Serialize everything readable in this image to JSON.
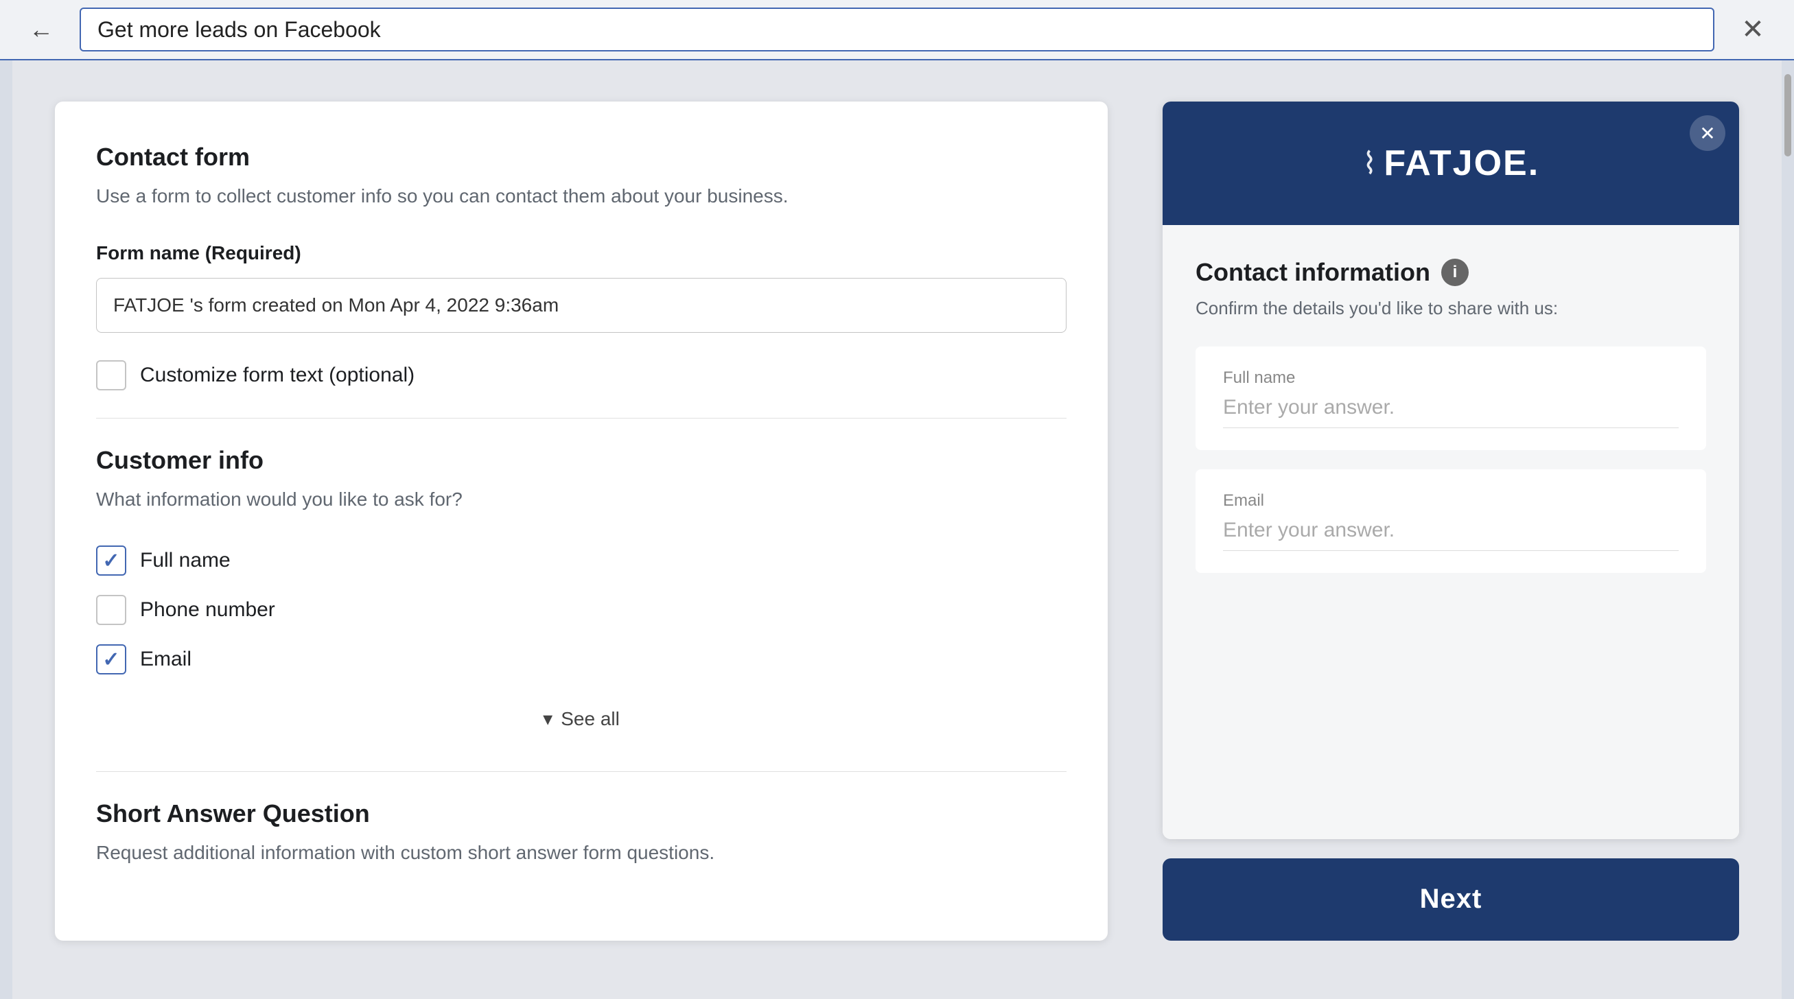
{
  "topBar": {
    "backLabel": "←",
    "addressText": "Get more leads on Facebook",
    "closeLabel": "✕"
  },
  "leftPanel": {
    "contactForm": {
      "title": "Contact form",
      "description": "Use a form to collect customer info so you can contact them about your business.",
      "formNameLabel": "Form name (Required)",
      "formNameValue": "FATJOE 's form created on Mon Apr 4, 2022 9:36am",
      "customizeLabel": "Customize form text (optional)"
    },
    "customerInfo": {
      "title": "Customer info",
      "description": "What information would you like to ask for?",
      "fields": [
        {
          "label": "Full name",
          "checked": true
        },
        {
          "label": "Phone number",
          "checked": false
        },
        {
          "label": "Email",
          "checked": true
        }
      ],
      "seeAllLabel": "See all"
    },
    "shortAnswer": {
      "title": "Short Answer Question",
      "description": "Request additional information with custom short answer form questions."
    }
  },
  "rightPanel": {
    "logo": "FATJOE.",
    "logoIcon": "⌇",
    "closeLabel": "✕",
    "contactInfo": {
      "title": "Contact information",
      "infoIcon": "i",
      "description": "Confirm the details you'd like to share with us:",
      "fields": [
        {
          "label": "Full name",
          "placeholder": "Enter your answer."
        },
        {
          "label": "Email",
          "placeholder": "Enter your answer."
        }
      ]
    },
    "nextButton": "Next"
  },
  "colors": {
    "brand": "#1e3a6e",
    "accent": "#4267B2",
    "checkColor": "#4267B2"
  }
}
